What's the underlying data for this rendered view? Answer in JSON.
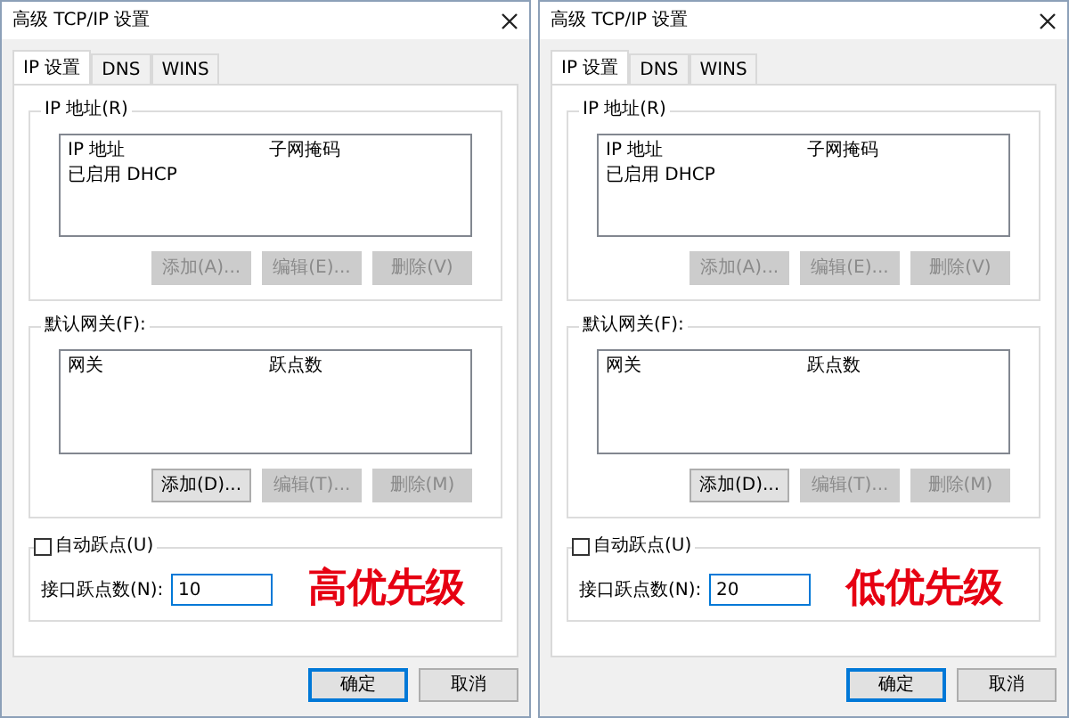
{
  "dialogs": [
    {
      "title": "高级 TCP/IP 设置",
      "tabs": [
        {
          "label": "IP 设置",
          "selected": true
        },
        {
          "label": "DNS",
          "selected": false
        },
        {
          "label": "WINS",
          "selected": false
        }
      ],
      "ip_group": {
        "label": "IP 地址(R)",
        "columns": [
          "IP 地址",
          "子网掩码"
        ],
        "rows": [
          [
            "已启用 DHCP",
            ""
          ]
        ],
        "buttons": [
          {
            "label": "添加(A)...",
            "disabled": true
          },
          {
            "label": "编辑(E)...",
            "disabled": true
          },
          {
            "label": "删除(V)",
            "disabled": true
          }
        ]
      },
      "gateway_group": {
        "label": "默认网关(F):",
        "columns": [
          "网关",
          "跃点数"
        ],
        "buttons": [
          {
            "label": "添加(D)...",
            "disabled": false
          },
          {
            "label": "编辑(T)...",
            "disabled": true
          },
          {
            "label": "删除(M)",
            "disabled": true
          }
        ]
      },
      "auto_metric": {
        "label": "自动跃点(U)",
        "checked": false
      },
      "interface_metric": {
        "label": "接口跃点数(N):",
        "value": "10"
      },
      "annotation": "高优先级",
      "buttons": [
        {
          "label": "确定",
          "default": true
        },
        {
          "label": "取消",
          "default": false
        }
      ]
    },
    {
      "title": "高级 TCP/IP 设置",
      "tabs": [
        {
          "label": "IP 设置",
          "selected": true
        },
        {
          "label": "DNS",
          "selected": false
        },
        {
          "label": "WINS",
          "selected": false
        }
      ],
      "ip_group": {
        "label": "IP 地址(R)",
        "columns": [
          "IP 地址",
          "子网掩码"
        ],
        "rows": [
          [
            "已启用 DHCP",
            ""
          ]
        ],
        "buttons": [
          {
            "label": "添加(A)...",
            "disabled": true
          },
          {
            "label": "编辑(E)...",
            "disabled": true
          },
          {
            "label": "删除(V)",
            "disabled": true
          }
        ]
      },
      "gateway_group": {
        "label": "默认网关(F):",
        "columns": [
          "网关",
          "跃点数"
        ],
        "buttons": [
          {
            "label": "添加(D)...",
            "disabled": false
          },
          {
            "label": "编辑(T)...",
            "disabled": true
          },
          {
            "label": "删除(M)",
            "disabled": true
          }
        ]
      },
      "auto_metric": {
        "label": "自动跃点(U)",
        "checked": false
      },
      "interface_metric": {
        "label": "接口跃点数(N):",
        "value": "20"
      },
      "annotation": "低优先级",
      "buttons": [
        {
          "label": "确定",
          "default": true
        },
        {
          "label": "取消",
          "default": false
        }
      ]
    }
  ]
}
